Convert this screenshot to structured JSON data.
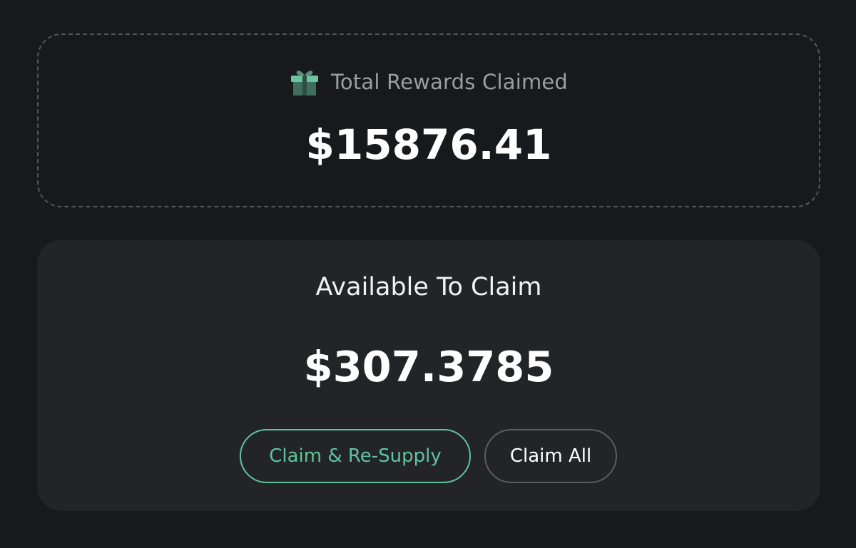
{
  "total_rewards": {
    "icon": "gift-icon",
    "label": "Total Rewards Claimed",
    "amount": "$15876.41"
  },
  "available": {
    "label": "Available To Claim",
    "amount": "$307.3785",
    "buttons": {
      "claim_resupply": "Claim & Re-Supply",
      "claim_all": "Claim All"
    }
  },
  "colors": {
    "background": "#18191d",
    "card": "#232428",
    "accent": "#5fc49d",
    "dashed_border": "#55575d"
  }
}
